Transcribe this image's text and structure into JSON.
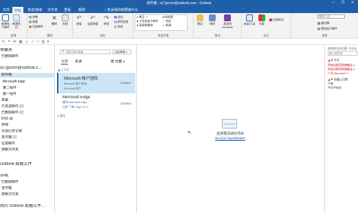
{
  "titlebar": {
    "title": "收件箱 - xz7jpcom@outlook.com - Outlook",
    "controls": [
      "—",
      "❐",
      "✕"
    ]
  },
  "tabs": [
    {
      "label": "文件",
      "active": false
    },
    {
      "label": "开始",
      "active": true
    },
    {
      "label": "发送/接收",
      "active": false
    },
    {
      "label": "文件夹",
      "active": false
    },
    {
      "label": "查看",
      "active": false
    },
    {
      "label": "帮助",
      "active": false
    }
  ],
  "tell_me": "告诉我你想要做什么",
  "ribbon": {
    "new_group": {
      "label": "新建",
      "new_email": "新建电子邮件",
      "new_items": "新建项目"
    },
    "delete_group": {
      "label": "删除",
      "ignore": "忽略",
      "cleanup": "清理",
      "junk": "垃圾邮件",
      "delete": "删除",
      "archive": "存档"
    },
    "respond_group": {
      "label": "响应",
      "reply": "答复",
      "reply_all": "全部答复",
      "forward": "转发",
      "meeting": "会议",
      "im": "即时消息",
      "more": "其他"
    },
    "quicksteps": {
      "label": "快速步骤",
      "items": [
        "移至: ?",
        "给经理",
        "工作组电子邮件",
        "完成",
        "答复和删除",
        "新建"
      ]
    },
    "move_group": {
      "label": "移动",
      "move": "移动",
      "rules": "规则",
      "onenote": "发送到 OneNote"
    },
    "tags_group": {
      "label": "标记",
      "unread": "未读/已读",
      "categorize": "分类",
      "followup": "后续标志"
    },
    "find_group": {
      "label": "查找",
      "search_people": "搜索人员",
      "address_book": "通讯簿",
      "filter_email": "筛选电子邮件"
    }
  },
  "folders": [
    {
      "label": "收藏夹",
      "big": true
    },
    {
      "label": "已删除邮件",
      "big": false
    },
    {
      "label": "xz7jpcom@outlook.c...",
      "big": true
    },
    {
      "label": "收件箱",
      "selected": true
    },
    {
      "label": "Microsoft edge"
    },
    {
      "label": "第二组件"
    },
    {
      "label": "第一组件"
    },
    {
      "label": "草稿"
    },
    {
      "label": "已发送邮件",
      "count": "[2]"
    },
    {
      "label": "已删除邮件",
      "count": "[2]"
    },
    {
      "label": "RSS 源"
    },
    {
      "label": "存档"
    },
    {
      "label": "对话历史记录"
    },
    {
      "label": "发件箱",
      "count": "[1]"
    },
    {
      "label": "垃圾邮件"
    },
    {
      "label": "搜索文件夹"
    },
    {
      "label": "Outlook 数据文件",
      "big": true
    },
    {
      "label": "存档",
      "big": true
    },
    {
      "label": "已删除邮件"
    },
    {
      "label": "发件箱"
    },
    {
      "label": "搜索文件夹"
    },
    {
      "label": "我的 Outlook 数据文件...",
      "big": true
    }
  ],
  "msglist": {
    "search_placeholder": "搜索当前 邮箱",
    "scope": "当前邮箱",
    "tab_all": "全部",
    "tab_unread": "未读",
    "sort": "按 日期 ∨",
    "group_this_month": "上个月",
    "group_older": "更早",
    "mails": [
      {
        "sender": "Microsoft 帐户团队",
        "subject": "Microsoft 帐户安全...",
        "preview": "Microsoft 帐户",
        "date": "2023/6/7",
        "selected": true
      },
      {
        "sender": "Microsoft Edge",
        "subject": "使用 Microsoft edge...",
        "preview": "立即 下载 Edge 13 小",
        "date": "2023/6/2",
        "selected": false
      }
    ]
  },
  "reading": {
    "message": "选择要阅读的项目",
    "link": "单击此处可始终预览邮件"
  },
  "todo": {
    "header": "即将发生的日程: 今天无",
    "input_placeholder": "键入新任务",
    "today": "今天",
    "tasks": [
      "阿迪达斯官网旗舰店 1",
      "阿迪达斯官网旗舰店 2",
      "广告 Microsoft 3"
    ],
    "no_date": "无截止日期",
    "next": "下周",
    "later": "今天不存在"
  }
}
